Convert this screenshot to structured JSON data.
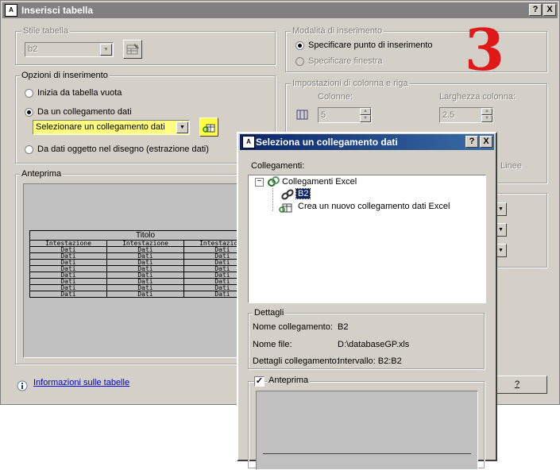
{
  "main_window": {
    "title": "Inserisci tabella",
    "help_btn": "?",
    "close_btn": "X",
    "table_style": {
      "label": "Stile tabella",
      "value": "b2"
    },
    "insert_options": {
      "label": "Opzioni di inserimento",
      "empty_table": "Inizia da tabella vuota",
      "data_link": "Da un collegamento dati",
      "data_link_combo": "Selezionare un collegamento dati",
      "object_data": "Da dati oggetto nel disegno (estrazione dati)"
    },
    "preview": {
      "label": "Anteprima",
      "table_title": "Titolo",
      "header_cell": "Intestazione",
      "data_cell": "Dati",
      "data_rows": 8
    },
    "insert_mode": {
      "label": "Modalità di inserimento",
      "point": "Specificare punto di inserimento",
      "window": "Specificare finestra"
    },
    "column_row": {
      "label": "Impostazioni di colonna e riga",
      "columns_label": "Colonne:",
      "columns_value": "5",
      "col_width_label": "Larghezza colonna:",
      "col_width_value": "2.5",
      "rows_partial": "Linee"
    },
    "info_link": "Informazioni sulle tabelle",
    "help_button": "?",
    "annotation_number": "3",
    "annotation_color": "#e01818"
  },
  "dialog": {
    "title": "Seleziona un collegamento dati",
    "help_btn": "?",
    "close_btn": "X",
    "links_label": "Collegamenti:",
    "tree": {
      "expander": "−",
      "root": "Collegamenti Excel",
      "items": [
        "B2",
        "Crea un nuovo collegamento dati Excel"
      ]
    },
    "details": {
      "label": "Dettagli",
      "rows": [
        {
          "key": "Nome collegamento:",
          "value": "B2"
        },
        {
          "key": "Nome file:",
          "value": "D:\\databaseGP.xls"
        },
        {
          "key": "Dettagli collegamento:",
          "value": "Intervallo: B2:B2"
        }
      ]
    },
    "preview": {
      "label": "Anteprima",
      "checked": true,
      "checkmark": "✓"
    }
  }
}
